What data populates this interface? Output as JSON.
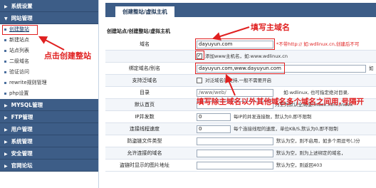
{
  "sidebar": {
    "system": "系统设置",
    "website": "网站管理",
    "items": [
      "创建整站",
      "新建站点",
      "站点列表",
      "二级域名",
      "验证访问",
      "rewrite规则管理",
      "php设置"
    ],
    "sections": [
      "MYSQL管理",
      "FTP管理",
      "用户管理",
      "系统管理",
      "安全管理",
      "官网论坛"
    ]
  },
  "header": {
    "tab": "创建整站/虚拟主机"
  },
  "breadcrumb": "创建站点/创建整站/虚拟主机",
  "form": {
    "domain_label": "域名",
    "domain_value": "dayuyun.com",
    "domain_note": "*不带http:// 如:wdlinux.cn,创建后不可",
    "www_checkbox": "添加www主机名，如:www.wdlinux.cn",
    "bind_label": "绑定域名/别名",
    "bind_value": "dayuyun.com,www.dayuyun.com",
    "bind_note": "如",
    "wildcard_label": "支持泛域名",
    "wildcard_text": "对泛域名的支持,一般不需要开启",
    "dir_label": "目录",
    "dir_value": "/www/web/",
    "dir_note": "如:wdlinux, 也可指定绝对目录,",
    "index_label": "默认首页",
    "index_note": "为空为默认全局值(index.html,index",
    "ip_label": "IP并发数",
    "ip_value": "0",
    "ip_note": "每IP的并发连接数，默认为0,即不限制",
    "speed_label": "连接线程速度",
    "speed_value": "0",
    "speed_note": "每个连接线程的速度，单位KB/S,默认为0,即不限制",
    "hotlink_label": "防盗链文件类型",
    "hotlink_note": "默认为空，则不启用，如多个用逗号(,)分",
    "allow_label": "允许连接的域名",
    "allow_note": "默认为空，则为上述绑定的域名，",
    "img_label": "盗链时显示的图片地址",
    "img_note": "默认为空，则返回403"
  },
  "annotations": {
    "fill_domain": "填写主域名",
    "click_create": "点击创建整站",
    "fill_alias": "填写除主域名以外其他域名多个域名之间用,号隔开"
  }
}
